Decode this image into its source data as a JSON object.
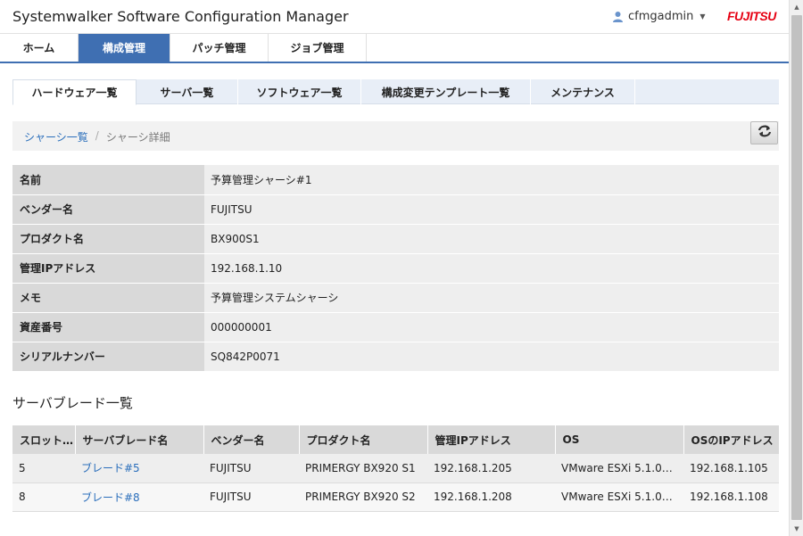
{
  "header": {
    "title": "Systemwalker Software Configuration Manager",
    "user": "cfmgadmin",
    "logo": "FUJITSU"
  },
  "main_nav": [
    {
      "label": "ホーム"
    },
    {
      "label": "構成管理",
      "active": true
    },
    {
      "label": "パッチ管理"
    },
    {
      "label": "ジョブ管理"
    }
  ],
  "sub_tabs": [
    {
      "label": "ハードウェア一覧",
      "active": true
    },
    {
      "label": "サーバ一覧"
    },
    {
      "label": "ソフトウェア一覧"
    },
    {
      "label": "構成変更テンプレート一覧"
    },
    {
      "label": "メンテナンス"
    }
  ],
  "breadcrumb": {
    "link": "シャーシ一覧",
    "separator": "/",
    "current": "シャーシ詳細"
  },
  "detail": [
    {
      "label": "名前",
      "value": "予算管理シャーシ#1"
    },
    {
      "label": "ベンダー名",
      "value": "FUJITSU"
    },
    {
      "label": "プロダクト名",
      "value": "BX900S1"
    },
    {
      "label": "管理IPアドレス",
      "value": "192.168.1.10"
    },
    {
      "label": "メモ",
      "value": "予算管理システムシャーシ"
    },
    {
      "label": "資産番号",
      "value": "000000001"
    },
    {
      "label": "シリアルナンバー",
      "value": "SQ842P0071"
    }
  ],
  "blade_section": {
    "title": "サーバブレード一覧",
    "columns": [
      "スロット…",
      "サーバブレード名",
      "ベンダー名",
      "プロダクト名",
      "管理IPアドレス",
      "OS",
      "OSのIPアドレス"
    ],
    "rows": [
      {
        "slot": "5",
        "name": "ブレード#5",
        "vendor": "FUJITSU",
        "product": "PRIMERGY BX920 S1",
        "mgmt_ip": "192.168.1.205",
        "os": "VMware ESXi 5.1.0…",
        "os_ip": "192.168.1.105"
      },
      {
        "slot": "8",
        "name": "ブレード#8",
        "vendor": "FUJITSU",
        "product": "PRIMERGY BX920 S2",
        "mgmt_ip": "192.168.1.208",
        "os": "VMware ESXi 5.1.0…",
        "os_ip": "192.168.1.108"
      }
    ]
  },
  "icons": {
    "user": "user-icon",
    "refresh": "refresh-icon"
  },
  "colors": {
    "accent": "#3f6fb2",
    "link": "#2a6ebb",
    "logo": "#e60012"
  }
}
